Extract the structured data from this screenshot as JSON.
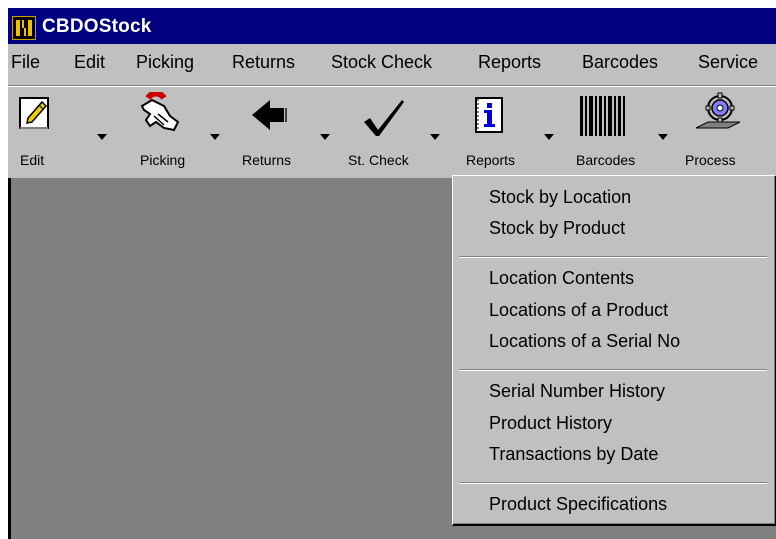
{
  "window": {
    "title": "CBDOStock"
  },
  "menubar": {
    "items": [
      "File",
      "Edit",
      "Picking",
      "Returns",
      "Stock Check",
      "Reports",
      "Barcodes",
      "Service"
    ]
  },
  "toolbar": {
    "buttons": [
      {
        "label": "Edit",
        "icon": "edit-pencil-icon"
      },
      {
        "label": "Picking",
        "icon": "picking-hand-icon"
      },
      {
        "label": "Returns",
        "icon": "returns-arrow-icon"
      },
      {
        "label": "St. Check",
        "icon": "checkmark-icon"
      },
      {
        "label": "Reports",
        "icon": "reports-info-icon"
      },
      {
        "label": "Barcodes",
        "icon": "barcode-icon"
      },
      {
        "label": "Process",
        "icon": "process-gear-icon"
      }
    ]
  },
  "reports_menu": {
    "groups": [
      [
        "Stock by Location",
        "Stock by Product"
      ],
      [
        "Location Contents",
        "Locations of a Product",
        "Locations of a Serial No"
      ],
      [
        "Serial Number History",
        "Product History",
        "Transactions by Date"
      ],
      [
        "Product Specifications"
      ]
    ]
  },
  "colors": {
    "title_bar": "#000080",
    "chrome": "#c0c0c0",
    "client_area": "#808080"
  }
}
